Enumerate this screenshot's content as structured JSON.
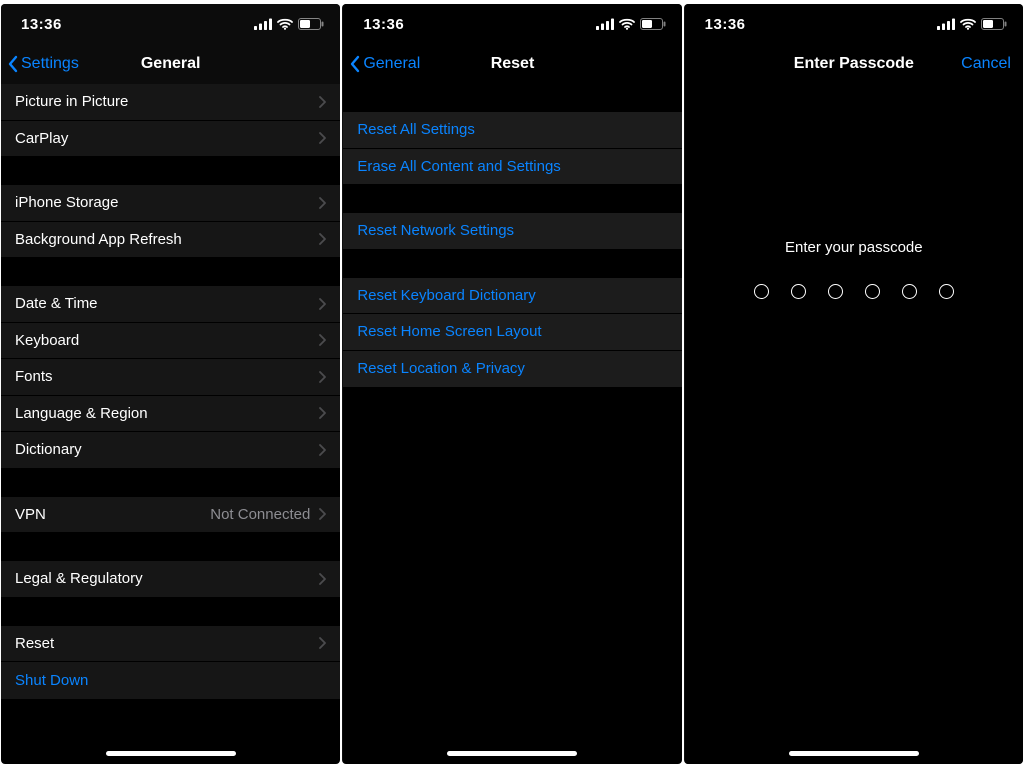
{
  "status": {
    "time": "13:36"
  },
  "screen1": {
    "back_label": "Settings",
    "title": "General",
    "items": {
      "pip": "Picture in Picture",
      "carplay": "CarPlay",
      "storage": "iPhone Storage",
      "bgrefresh": "Background App Refresh",
      "datetime": "Date & Time",
      "keyboard": "Keyboard",
      "fonts": "Fonts",
      "langregion": "Language & Region",
      "dictionary": "Dictionary",
      "vpn": "VPN",
      "vpn_value": "Not Connected",
      "legal": "Legal & Regulatory",
      "reset": "Reset",
      "shutdown": "Shut Down"
    }
  },
  "screen2": {
    "back_label": "General",
    "title": "Reset",
    "items": {
      "reset_all": "Reset All Settings",
      "erase_all": "Erase All Content and Settings",
      "reset_network": "Reset Network Settings",
      "reset_keyboard": "Reset Keyboard Dictionary",
      "reset_home": "Reset Home Screen Layout",
      "reset_location": "Reset Location & Privacy"
    }
  },
  "screen3": {
    "title": "Enter Passcode",
    "cancel": "Cancel",
    "prompt": "Enter your passcode",
    "digits": 6
  }
}
